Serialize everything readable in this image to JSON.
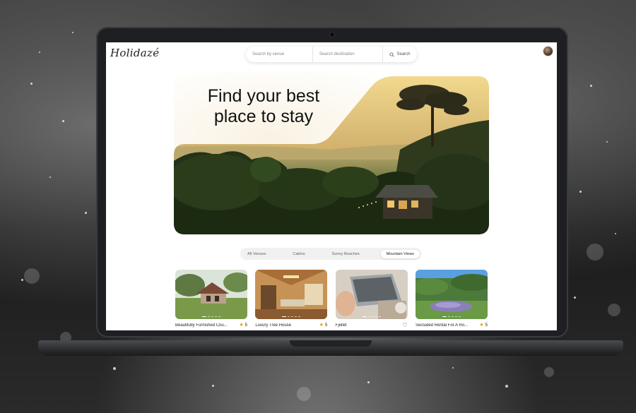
{
  "app": {
    "logo_text": "Holidazé"
  },
  "search": {
    "venue_placeholder": "Search by venue",
    "destination_placeholder": "Search destination",
    "button_label": "Search"
  },
  "hero": {
    "title_line1": "Find your best",
    "title_line2": "place to stay"
  },
  "tabs": [
    {
      "label": "All Venues",
      "active": false
    },
    {
      "label": "Cabins",
      "active": false
    },
    {
      "label": "Sunny Beaches",
      "active": false
    },
    {
      "label": "Mountain Views",
      "active": true
    }
  ],
  "cards": [
    {
      "title": "Beautifully Furnished Cou...",
      "rating": "5",
      "favorite_icon": "star-icon"
    },
    {
      "title": "Luxury Tree House",
      "rating": "5",
      "favorite_icon": "star-icon"
    },
    {
      "title": "Fjellet",
      "rating": "",
      "favorite_icon": "heart-icon"
    },
    {
      "title": "Secluded Rental For A Ro...",
      "rating": "5",
      "favorite_icon": "star-icon"
    }
  ],
  "colors": {
    "accent_star": "#e0a100",
    "tab_active_bg": "#ffffff",
    "tab_bar_bg": "#f1f1f1"
  }
}
